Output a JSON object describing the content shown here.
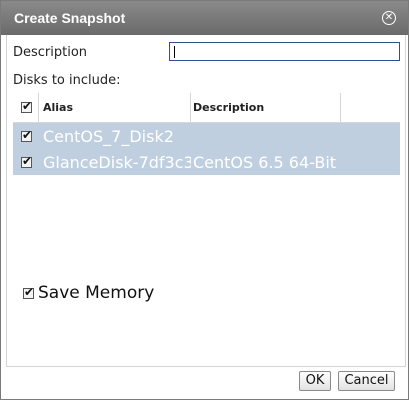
{
  "dialog": {
    "title": "Create Snapshot",
    "close_icon": "close-icon"
  },
  "form": {
    "description_label": "Description",
    "description_value": "",
    "disks_label": "Disks to include:"
  },
  "disks_table": {
    "columns": [
      "Alias",
      "Description"
    ],
    "select_all_checked": true,
    "rows": [
      {
        "alias": "CentOS_7_Disk2",
        "description": "",
        "checked": true
      },
      {
        "alias": "GlanceDisk-7df3c3",
        "description": "CentOS 6.5 64-Bit",
        "checked": true
      }
    ]
  },
  "save_memory": {
    "label": "Save Memory",
    "checked": true
  },
  "buttons": {
    "ok": "OK",
    "cancel": "Cancel"
  },
  "colors": {
    "titlebar": "#777777",
    "selected_row": "#bfcfdf",
    "input_border": "#2f4f8f"
  }
}
